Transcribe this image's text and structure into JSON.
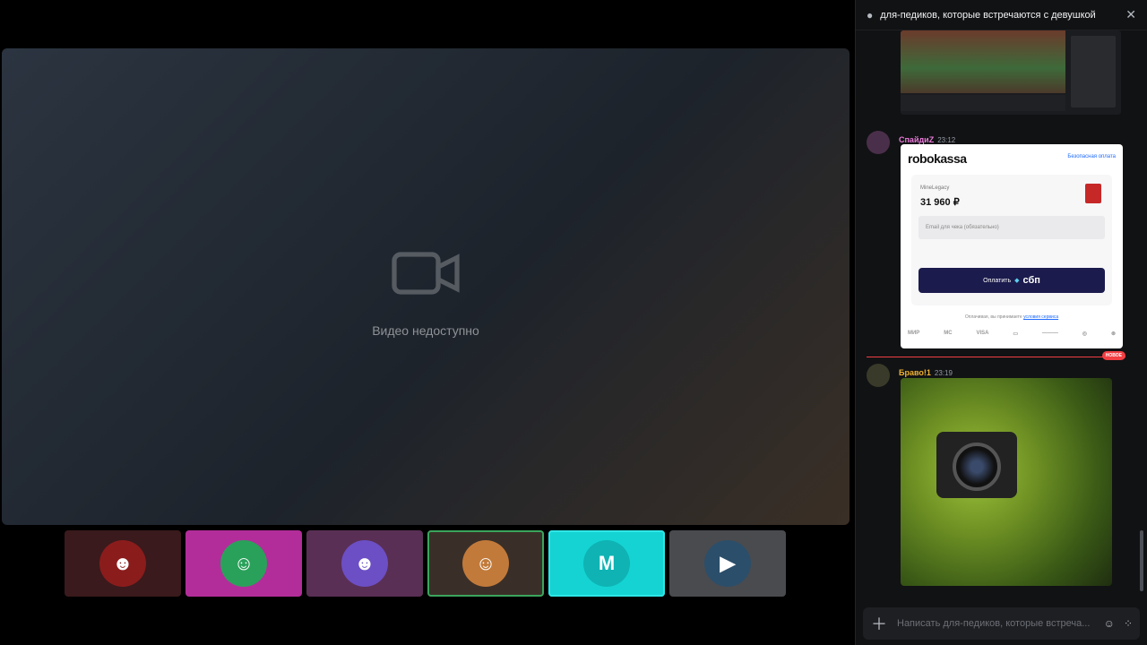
{
  "video": {
    "placeholder": "Видео недоступно"
  },
  "tiles": [
    {
      "bg": "#3a1a1c",
      "av": "#8b1c1c",
      "glyph": "☻"
    },
    {
      "bg": "#b32d9a",
      "av": "#2aa15a",
      "glyph": "☺"
    },
    {
      "bg": "#5a2f55",
      "av": "#6c4fc4",
      "glyph": "☻"
    },
    {
      "bg": "#3a2f28",
      "av": "#c27a3a",
      "glyph": "☺"
    },
    {
      "bg": "#15d3d3",
      "av": "#0fb3b3",
      "glyph": "M"
    },
    {
      "bg": "#4a4b4f",
      "av": "#2b4e6a",
      "glyph": "▶"
    }
  ],
  "chat": {
    "title": "для-педиков, которые встречаются с девушкой",
    "messages": [
      {
        "author": "СпайдиZ",
        "time": "23:12",
        "color": "#e97ad9"
      },
      {
        "author": "Браво!1",
        "time": "23:19",
        "color": "#f0b232"
      }
    ],
    "new_label": "НОВОЕ",
    "input_placeholder": "Написать для-педиков, которые встреча..."
  },
  "robokassa": {
    "logo": "robokassa",
    "secure": "Безопасная оплата",
    "merchant": "MineLegacy",
    "amount": "31 960 ₽",
    "email_placeholder": "Email для чека (обязательно)",
    "pay_label": "Оплатить",
    "pay_brand": "сбп",
    "agree": "Оплачивая, вы принимаете",
    "terms": "условия сервиса",
    "marks": [
      "МИР",
      "MC",
      "VISA",
      "▭",
      "———",
      "◎",
      "⊛"
    ]
  }
}
